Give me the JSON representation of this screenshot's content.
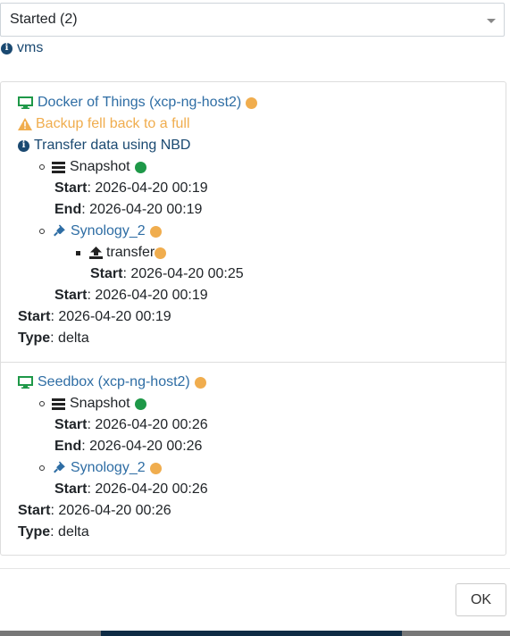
{
  "filter": {
    "selected": "Started (2)"
  },
  "scope_label": "vms",
  "colors": {
    "link": "#2e6da4",
    "warning": "#f0ad4e",
    "success": "#1e9848",
    "pending": "#f0ad4e",
    "info": "#1a4971"
  },
  "tasks": [
    {
      "vm_name": "Docker of Things (xcp-ng-host2)",
      "status": "pending",
      "warning": "Backup fell back to a full",
      "info": "Transfer data using NBD",
      "snapshot": {
        "label": "Snapshot",
        "status": "success",
        "start_label": "Start",
        "start": ": 2026-04-20 00:19",
        "end_label": "End",
        "end": ": 2026-04-20 00:19"
      },
      "remote": {
        "label": "Synology_2",
        "status": "pending",
        "transfer": {
          "label": "transfer",
          "status": "pending",
          "start_label": "Start",
          "start": ": 2026-04-20 00:25"
        },
        "start_label": "Start",
        "start": ": 2026-04-20 00:19"
      },
      "start_label": "Start",
      "start": ": 2026-04-20 00:19",
      "type_label": "Type",
      "type": ": delta"
    },
    {
      "vm_name": "Seedbox (xcp-ng-host2)",
      "status": "pending",
      "snapshot": {
        "label": "Snapshot",
        "status": "success",
        "start_label": "Start",
        "start": ": 2026-04-20 00:26",
        "end_label": "End",
        "end": ": 2026-04-20 00:26"
      },
      "remote": {
        "label": "Synology_2",
        "status": "pending",
        "start_label": "Start",
        "start": ": 2026-04-20 00:26"
      },
      "start_label": "Start",
      "start": ": 2026-04-20 00:26",
      "type_label": "Type",
      "type": ": delta"
    }
  ],
  "ok_label": "OK"
}
